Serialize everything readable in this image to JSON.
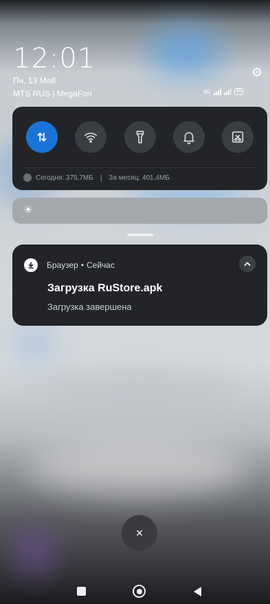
{
  "status": {
    "time": "12:01",
    "date": "Пн, 13 Май",
    "carriers": "MTS RUS | MegaFon",
    "network_type": "4G",
    "battery": "40"
  },
  "quick_settings": {
    "tiles": [
      {
        "name": "mobile-data",
        "icon": "data-transfer-icon",
        "active": true
      },
      {
        "name": "wifi",
        "icon": "wifi-icon",
        "active": false
      },
      {
        "name": "flashlight",
        "icon": "flashlight-icon",
        "active": false
      },
      {
        "name": "sound",
        "icon": "bell-icon",
        "active": false
      },
      {
        "name": "screenshot",
        "icon": "screenshot-icon",
        "active": false
      }
    ],
    "data_today": "Сегодня: 375,7МБ",
    "separator": "|",
    "data_month": "За месяц: 401,4МБ"
  },
  "brightness": {
    "icon": "sun-icon"
  },
  "notification": {
    "app_name": "Браузер",
    "dot": "•",
    "time": "Сейчас",
    "title": "Загрузка RuStore.apk",
    "text": "Загрузка завершена"
  },
  "clear_button": {
    "label": "×"
  },
  "colors": {
    "accent": "#1a73d6",
    "panel": "#222428"
  }
}
